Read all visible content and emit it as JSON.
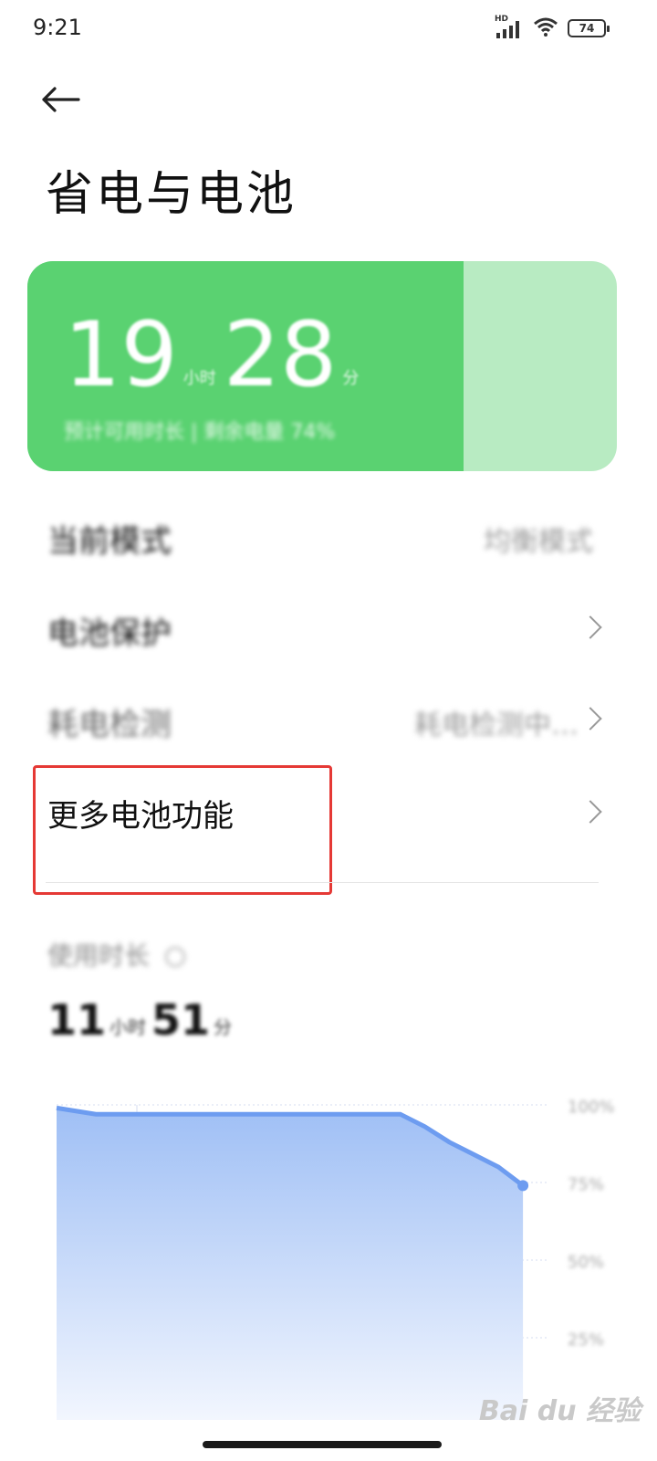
{
  "status_bar": {
    "time": "9:21",
    "network": "HD",
    "battery_level": 74
  },
  "page": {
    "title": "省电与电池"
  },
  "battery_card": {
    "time_hours": "19",
    "hours_unit": "小时",
    "time_minutes": "28",
    "minutes_unit": "分",
    "subtitle": "预计可用时长 | 剩余电量 74%",
    "charge_fraction": 0.74,
    "fill_color": "#5ad271",
    "empty_color": "#b8ebc2"
  },
  "menu": [
    {
      "label": "当前模式",
      "value": "均衡模式",
      "blurred": true
    },
    {
      "label": "电池保护",
      "value": "",
      "blurred": true
    },
    {
      "label": "耗电检测",
      "value": "耗电检测中…",
      "blurred": true
    },
    {
      "label": "更多电池功能",
      "value": "",
      "blurred": false
    }
  ],
  "usage": {
    "label": "使用时长",
    "hours": "11",
    "hours_unit": "小时",
    "minutes": "51",
    "minutes_unit": "分"
  },
  "chart_data": {
    "type": "area",
    "y_ticks": [
      "100%",
      "75%",
      "50%",
      "25%"
    ],
    "ylim": [
      0,
      100
    ],
    "xlim": [
      0,
      100
    ],
    "x": [
      0,
      8,
      16,
      30,
      50,
      70,
      75,
      80,
      85,
      90,
      95
    ],
    "values": [
      99,
      97,
      97,
      97,
      97,
      97,
      93,
      88,
      84,
      80,
      74
    ],
    "color": "#6d9cf0"
  },
  "watermark": "Bai du 经验"
}
